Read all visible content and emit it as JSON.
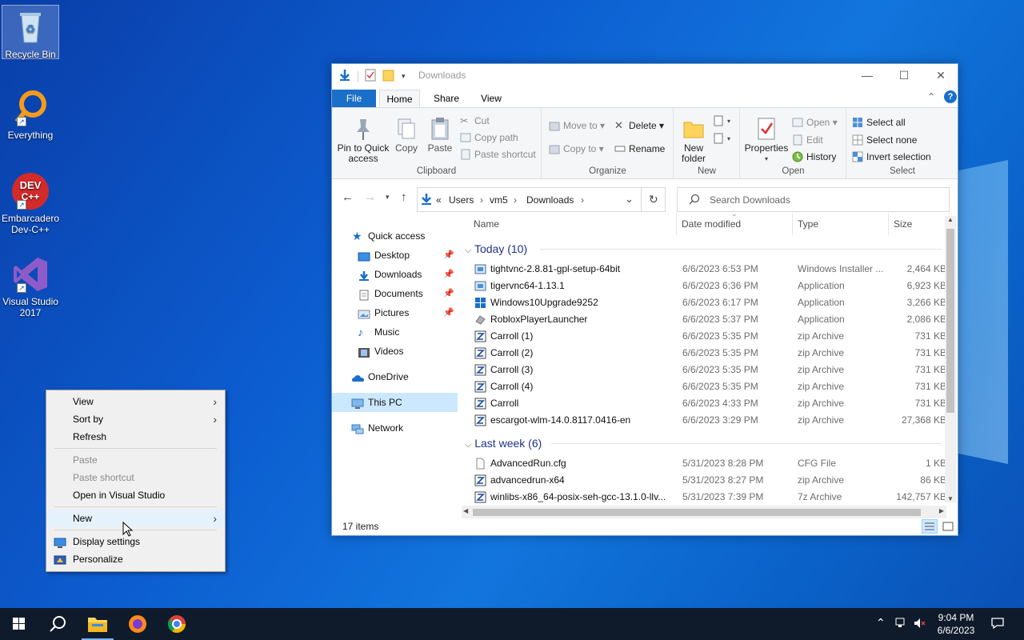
{
  "desktop": {
    "icons": [
      {
        "label": "Recycle Bin"
      },
      {
        "label": "Everything"
      },
      {
        "label": "Embarcadero Dev-C++"
      },
      {
        "label": "Visual Studio 2017"
      }
    ]
  },
  "context_menu": {
    "items": {
      "view": "View",
      "sort_by": "Sort by",
      "refresh": "Refresh",
      "paste": "Paste",
      "paste_shortcut": "Paste shortcut",
      "open_vs": "Open in Visual Studio",
      "new": "New",
      "display_settings": "Display settings",
      "personalize": "Personalize"
    }
  },
  "explorer": {
    "title": "Downloads",
    "tabs": {
      "file": "File",
      "home": "Home",
      "share": "Share",
      "view": "View"
    },
    "ribbon": {
      "pin": "Pin to Quick access",
      "copy": "Copy",
      "paste": "Paste",
      "cut": "Cut",
      "copy_path": "Copy path",
      "paste_shortcut": "Paste shortcut",
      "clipboard": "Clipboard",
      "move_to": "Move to",
      "copy_to": "Copy to",
      "delete": "Delete",
      "rename": "Rename",
      "organize": "Organize",
      "new_folder": "New folder",
      "new": "New",
      "properties": "Properties",
      "open": "Open",
      "edit": "Edit",
      "history": "History",
      "open_group": "Open",
      "select_all": "Select all",
      "select_none": "Select none",
      "invert_selection": "Invert selection",
      "select": "Select"
    },
    "address": {
      "prefix": "«",
      "parts": [
        "Users",
        "vm5",
        "Downloads"
      ]
    },
    "search_placeholder": "Search Downloads",
    "nav": {
      "quick_access": "Quick access",
      "desktop": "Desktop",
      "downloads": "Downloads",
      "documents": "Documents",
      "pictures": "Pictures",
      "music": "Music",
      "videos": "Videos",
      "onedrive": "OneDrive",
      "this_pc": "This PC",
      "network": "Network"
    },
    "columns": {
      "name": "Name",
      "date": "Date modified",
      "type": "Type",
      "size": "Size"
    },
    "groups": {
      "today": "Today (10)",
      "last_week": "Last week (6)"
    },
    "files": [
      {
        "name": "tightvnc-2.8.81-gpl-setup-64bit",
        "date": "6/6/2023 6:53 PM",
        "type": "Windows Installer ...",
        "size": "2,464 KB",
        "icon": "installer-icon"
      },
      {
        "name": "tigervnc64-1.13.1",
        "date": "6/6/2023 6:36 PM",
        "type": "Application",
        "size": "6,923 KB",
        "icon": "installer-icon"
      },
      {
        "name": "Windows10Upgrade9252",
        "date": "6/6/2023 6:17 PM",
        "type": "Application",
        "size": "3,266 KB",
        "icon": "windows-icon"
      },
      {
        "name": "RobloxPlayerLauncher",
        "date": "6/6/2023 5:37 PM",
        "type": "Application",
        "size": "2,086 KB",
        "icon": "app-icon"
      },
      {
        "name": "Carroll (1)",
        "date": "6/6/2023 5:35 PM",
        "type": "zip Archive",
        "size": "731 KB",
        "icon": "zip-icon"
      },
      {
        "name": "Carroll (2)",
        "date": "6/6/2023 5:35 PM",
        "type": "zip Archive",
        "size": "731 KB",
        "icon": "zip-icon"
      },
      {
        "name": "Carroll (3)",
        "date": "6/6/2023 5:35 PM",
        "type": "zip Archive",
        "size": "731 KB",
        "icon": "zip-icon"
      },
      {
        "name": "Carroll (4)",
        "date": "6/6/2023 5:35 PM",
        "type": "zip Archive",
        "size": "731 KB",
        "icon": "zip-icon"
      },
      {
        "name": "Carroll",
        "date": "6/6/2023 4:33 PM",
        "type": "zip Archive",
        "size": "731 KB",
        "icon": "zip-icon"
      },
      {
        "name": "escargot-wlm-14.0.8117.0416-en",
        "date": "6/6/2023 3:29 PM",
        "type": "zip Archive",
        "size": "27,368 KB",
        "icon": "zip-icon"
      },
      {
        "name": "AdvancedRun.cfg",
        "date": "5/31/2023 8:28 PM",
        "type": "CFG File",
        "size": "1 KB",
        "icon": "file-icon"
      },
      {
        "name": "advancedrun-x64",
        "date": "5/31/2023 8:27 PM",
        "type": "zip Archive",
        "size": "86 KB",
        "icon": "zip-icon"
      },
      {
        "name": "winlibs-x86_64-posix-seh-gcc-13.1.0-llv...",
        "date": "5/31/2023 7:39 PM",
        "type": "7z Archive",
        "size": "142,757 KB",
        "icon": "zip-icon"
      }
    ],
    "status": "17 items"
  },
  "taskbar": {
    "time": "9:04 PM",
    "date": "6/6/2023"
  }
}
